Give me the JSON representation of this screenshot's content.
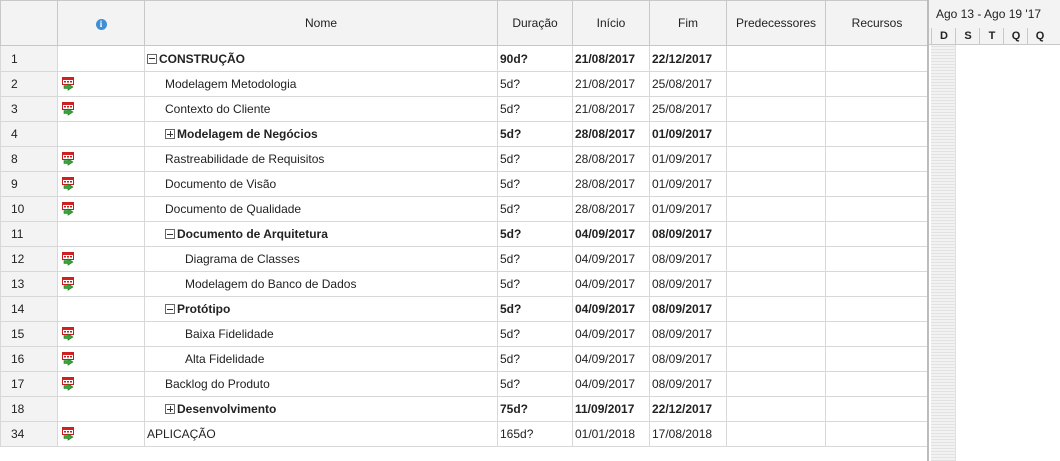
{
  "columns": {
    "indicators_icon": "info-icon",
    "name": "Nome",
    "duration": "Duração",
    "start": "Início",
    "finish": "Fim",
    "predecessors": "Predecessores",
    "resources": "Recursos"
  },
  "gantt": {
    "week_label": "Ago 13 - Ago 19 '17",
    "days": [
      "D",
      "S",
      "T",
      "Q",
      "Q"
    ]
  },
  "rows": [
    {
      "id": "1",
      "name": "CONSTRUÇÃO",
      "level": 0,
      "summary": true,
      "toggle": "minus",
      "icon": false,
      "duration": "90d?",
      "start": "21/08/2017",
      "finish": "22/12/2017",
      "predecessors": "",
      "resources": ""
    },
    {
      "id": "2",
      "name": "Modelagem Metodologia",
      "level": 1,
      "summary": false,
      "toggle": "",
      "icon": true,
      "duration": "5d?",
      "start": "21/08/2017",
      "finish": "25/08/2017",
      "predecessors": "",
      "resources": ""
    },
    {
      "id": "3",
      "name": "Contexto do Cliente",
      "level": 1,
      "summary": false,
      "toggle": "",
      "icon": true,
      "duration": "5d?",
      "start": "21/08/2017",
      "finish": "25/08/2017",
      "predecessors": "",
      "resources": ""
    },
    {
      "id": "4",
      "name": "Modelagem de Negócios",
      "level": 1,
      "summary": true,
      "toggle": "plus",
      "icon": false,
      "duration": "5d?",
      "start": "28/08/2017",
      "finish": "01/09/2017",
      "predecessors": "",
      "resources": ""
    },
    {
      "id": "8",
      "name": "Rastreabilidade de Requisitos",
      "level": 1,
      "summary": false,
      "toggle": "",
      "icon": true,
      "duration": "5d?",
      "start": "28/08/2017",
      "finish": "01/09/2017",
      "predecessors": "",
      "resources": ""
    },
    {
      "id": "9",
      "name": "Documento de Visão",
      "level": 1,
      "summary": false,
      "toggle": "",
      "icon": true,
      "duration": "5d?",
      "start": "28/08/2017",
      "finish": "01/09/2017",
      "predecessors": "",
      "resources": ""
    },
    {
      "id": "10",
      "name": "Documento de Qualidade",
      "level": 1,
      "summary": false,
      "toggle": "",
      "icon": true,
      "duration": "5d?",
      "start": "28/08/2017",
      "finish": "01/09/2017",
      "predecessors": "",
      "resources": ""
    },
    {
      "id": "11",
      "name": "Documento de Arquitetura",
      "level": 1,
      "summary": true,
      "toggle": "minus",
      "icon": false,
      "duration": "5d?",
      "start": "04/09/2017",
      "finish": "08/09/2017",
      "predecessors": "",
      "resources": ""
    },
    {
      "id": "12",
      "name": "Diagrama de Classes",
      "level": 2,
      "summary": false,
      "toggle": "",
      "icon": true,
      "duration": "5d?",
      "start": "04/09/2017",
      "finish": "08/09/2017",
      "predecessors": "",
      "resources": ""
    },
    {
      "id": "13",
      "name": "Modelagem do Banco de Dados",
      "level": 2,
      "summary": false,
      "toggle": "",
      "icon": true,
      "duration": "5d?",
      "start": "04/09/2017",
      "finish": "08/09/2017",
      "predecessors": "",
      "resources": ""
    },
    {
      "id": "14",
      "name": "Protótipo",
      "level": 1,
      "summary": true,
      "toggle": "minus",
      "icon": false,
      "duration": "5d?",
      "start": "04/09/2017",
      "finish": "08/09/2017",
      "predecessors": "",
      "resources": ""
    },
    {
      "id": "15",
      "name": "Baixa Fidelidade",
      "level": 2,
      "summary": false,
      "toggle": "",
      "icon": true,
      "duration": "5d?",
      "start": "04/09/2017",
      "finish": "08/09/2017",
      "predecessors": "",
      "resources": ""
    },
    {
      "id": "16",
      "name": "Alta Fidelidade",
      "level": 2,
      "summary": false,
      "toggle": "",
      "icon": true,
      "duration": "5d?",
      "start": "04/09/2017",
      "finish": "08/09/2017",
      "predecessors": "",
      "resources": ""
    },
    {
      "id": "17",
      "name": "Backlog do Produto",
      "level": 1,
      "summary": false,
      "toggle": "",
      "icon": true,
      "duration": "5d?",
      "start": "04/09/2017",
      "finish": "08/09/2017",
      "predecessors": "",
      "resources": ""
    },
    {
      "id": "18",
      "name": "Desenvolvimento",
      "level": 1,
      "summary": true,
      "toggle": "plus",
      "icon": false,
      "duration": "75d?",
      "start": "11/09/2017",
      "finish": "22/12/2017",
      "predecessors": "",
      "resources": ""
    },
    {
      "id": "34",
      "name": "APLICAÇÃO",
      "level": 0,
      "summary": false,
      "toggle": "",
      "icon": true,
      "duration": "165d?",
      "start": "01/01/2018",
      "finish": "17/08/2018",
      "predecessors": "",
      "resources": ""
    }
  ]
}
